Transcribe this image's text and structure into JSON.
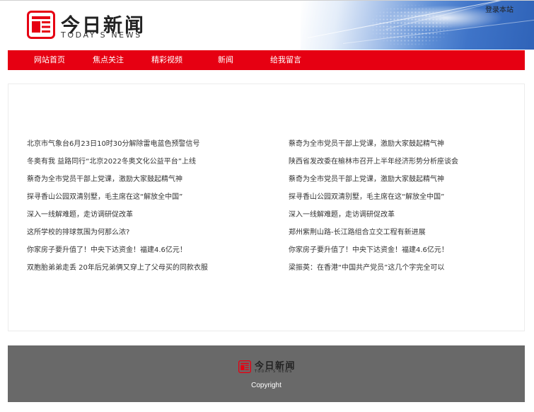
{
  "brand": {
    "name": "今日新闻",
    "subtitle": "TODAY'S NEWS",
    "accent": "#e60012"
  },
  "header": {
    "login_link": "登录本站"
  },
  "nav": {
    "items": [
      "网站首页",
      "焦点关注",
      "精彩视频",
      "新闻",
      "给我留言"
    ]
  },
  "news": {
    "left": [
      "北京市气象台6月23日10时30分解除雷电蓝色预警信号",
      "冬奥有我 益路同行“北京2022冬奥文化公益平台”上线",
      "蔡奇为全市党员干部上党课，激励大家鼓起精气神",
      "探寻香山公园双清别墅，毛主席在这“解放全中国”",
      "深入一线解难题，走访调研促改革",
      "这所学校的排球氛围为何那么浓?",
      "你家房子要升值了！中央下达资金！福建4.6亿元！",
      "双胞胎弟弟走丢 20年后兄弟俩又穿上了父母买的同款衣服"
    ],
    "right": [
      "蔡奇为全市党员干部上党课，激励大家鼓起精气神",
      "陕西省发改委在榆林市召开上半年经济形势分析座谈会",
      "蔡奇为全市党员干部上党课，激励大家鼓起精气神",
      "探寻香山公园双清别墅，毛主席在这“解放全中国”",
      "深入一线解难题，走访调研促改革",
      "郑州紫荆山路-长江路组合立交工程有新进展",
      "你家房子要升值了！中央下达资金！福建4.6亿元！",
      "梁振英：在香港“中国共产党员”这几个字完全可以"
    ]
  },
  "footer": {
    "copyright": "Copyright"
  }
}
